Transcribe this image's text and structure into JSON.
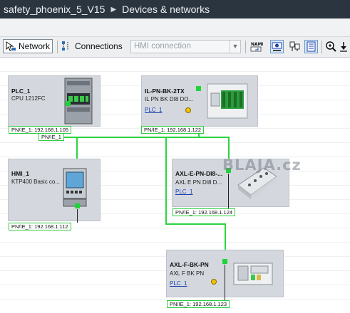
{
  "window": {
    "project": "safety_phoenix_5_V15",
    "view": "Devices & networks"
  },
  "toolbar": {
    "network_label": "Network",
    "connections_label": "Connections",
    "connection_type": "HMI connection"
  },
  "devices": [
    {
      "name": "PLC_1",
      "type": "CPU 1212FC",
      "address": "PN/IE_1: 192.168.1.105"
    },
    {
      "name": "IL-PN-BK-2TX",
      "type": "IL PN BK DI8 DO...",
      "link": "PLC_1",
      "address": "PN/IE_1: 192.168.1.122"
    },
    {
      "name": "HMI_1",
      "type": "KTP400 Basic co...",
      "address": "PN/IE_1: 192.168.1.112"
    },
    {
      "name": "AXL-E-PN-DI8-...",
      "type": "AXL E PN DI8 D...",
      "link": "PLC_1",
      "address": "PN/IE_1: 192.168.1.124"
    },
    {
      "name": "AXL-F-BK-PN",
      "type": "AXL F BK PN",
      "link": "PLC_1",
      "address": "PN/IE_1: 192.168.1.123"
    }
  ],
  "network": {
    "subnet_label": "PN/IE_1",
    "color": "#2bd43f"
  },
  "watermark": "BLAJA.cz"
}
